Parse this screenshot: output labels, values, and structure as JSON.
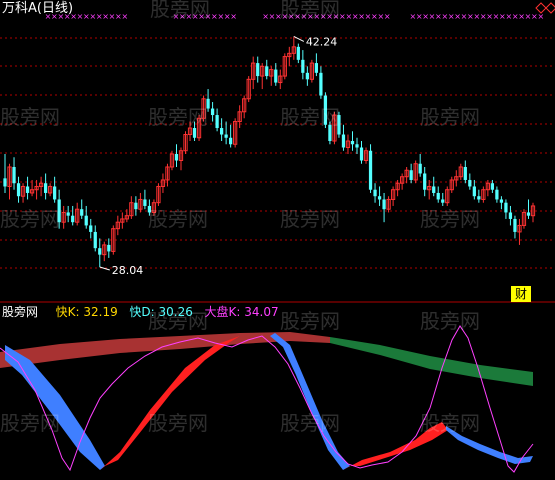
{
  "title": "万科A(日线)",
  "watermark": "股旁网",
  "badge": "财",
  "indicator_name": "股旁网",
  "labels": {
    "high": "42.24",
    "low": "28.04",
    "fastK": "快K: 32.19",
    "fastD": "快D: 30.26",
    "bigK": "大盘K: 34.07"
  },
  "colors": {
    "bg": "#000000",
    "up": "#ff3232",
    "down": "#54ffff",
    "grid": "#b00000",
    "title": "#ffffff",
    "fastK": "#ffd700",
    "fastD": "#54ffff",
    "bigK": "#ff40ff",
    "marker": "#ff40ff",
    "band_up": "#ff2020",
    "band_down": "#3f7fff",
    "band_dark_red": "#a83232",
    "band_green": "#1b7a3a",
    "badge_bg": "#ffff00",
    "badge_text": "#000000"
  },
  "chart_data": [
    {
      "type": "candlestick",
      "title": "万科A(日线)",
      "ylim": [
        26.5,
        43.5
      ],
      "annotations": [
        {
          "text": "42.24",
          "value": 42.24,
          "index": 64
        },
        {
          "text": "28.04",
          "value": 28.04,
          "index": 21
        }
      ],
      "ohlc": [
        [
          33.5,
          35.0,
          32.6,
          33.0
        ],
        [
          33.0,
          34.4,
          32.2,
          34.2
        ],
        [
          34.2,
          34.8,
          32.8,
          33.2
        ],
        [
          33.2,
          33.6,
          32.0,
          32.4
        ],
        [
          32.4,
          33.2,
          32.0,
          33.0
        ],
        [
          33.0,
          33.6,
          32.2,
          32.6
        ],
        [
          32.6,
          33.4,
          32.4,
          32.8
        ],
        [
          32.8,
          33.4,
          32.2,
          33.0
        ],
        [
          33.0,
          33.6,
          32.4,
          33.2
        ],
        [
          33.2,
          33.8,
          32.2,
          32.6
        ],
        [
          32.6,
          33.2,
          32.4,
          33.0
        ],
        [
          33.0,
          33.6,
          32.0,
          32.2
        ],
        [
          32.2,
          32.8,
          30.4,
          30.8
        ],
        [
          30.8,
          31.8,
          30.4,
          31.4
        ],
        [
          31.4,
          31.8,
          30.8,
          31.2
        ],
        [
          31.2,
          31.8,
          30.6,
          30.8
        ],
        [
          30.8,
          32.0,
          30.6,
          31.6
        ],
        [
          31.6,
          32.2,
          31.0,
          31.2
        ],
        [
          31.2,
          31.8,
          30.4,
          30.6
        ],
        [
          30.6,
          31.0,
          29.8,
          30.2
        ],
        [
          30.2,
          30.6,
          29.0,
          29.2
        ],
        [
          29.2,
          29.8,
          28.04,
          28.8
        ],
        [
          28.8,
          29.6,
          28.4,
          29.4
        ],
        [
          29.4,
          29.8,
          28.6,
          29.0
        ],
        [
          29.0,
          30.6,
          28.8,
          30.4
        ],
        [
          30.4,
          31.2,
          30.0,
          30.8
        ],
        [
          30.8,
          31.4,
          30.4,
          31.0
        ],
        [
          31.0,
          31.6,
          30.8,
          31.2
        ],
        [
          31.2,
          32.4,
          31.0,
          32.0
        ],
        [
          32.0,
          32.4,
          31.2,
          31.6
        ],
        [
          31.6,
          32.6,
          31.4,
          32.2
        ],
        [
          32.2,
          32.8,
          31.6,
          31.8
        ],
        [
          31.8,
          32.2,
          31.2,
          31.4
        ],
        [
          31.4,
          32.2,
          31.2,
          32.0
        ],
        [
          32.0,
          33.2,
          31.8,
          33.0
        ],
        [
          33.0,
          33.8,
          32.6,
          33.4
        ],
        [
          33.4,
          34.4,
          33.0,
          34.2
        ],
        [
          34.2,
          35.2,
          34.0,
          35.0
        ],
        [
          35.0,
          35.6,
          34.2,
          34.6
        ],
        [
          34.6,
          35.4,
          34.0,
          35.2
        ],
        [
          35.2,
          36.4,
          35.0,
          36.2
        ],
        [
          36.2,
          37.0,
          35.8,
          36.6
        ],
        [
          36.6,
          37.0,
          35.8,
          36.0
        ],
        [
          36.0,
          37.4,
          35.8,
          37.2
        ],
        [
          37.2,
          38.6,
          37.0,
          38.4
        ],
        [
          38.4,
          39.0,
          37.6,
          37.8
        ],
        [
          37.8,
          38.2,
          37.0,
          37.4
        ],
        [
          37.4,
          37.8,
          36.4,
          36.6
        ],
        [
          36.6,
          37.2,
          35.8,
          36.2
        ],
        [
          36.2,
          37.0,
          35.6,
          36.0
        ],
        [
          36.0,
          36.8,
          35.4,
          35.6
        ],
        [
          35.6,
          37.2,
          35.4,
          37.0
        ],
        [
          37.0,
          38.0,
          36.6,
          37.6
        ],
        [
          37.6,
          38.6,
          37.2,
          38.4
        ],
        [
          38.4,
          39.8,
          38.2,
          39.6
        ],
        [
          39.6,
          41.0,
          39.0,
          40.6
        ],
        [
          40.6,
          41.0,
          39.4,
          39.8
        ],
        [
          39.8,
          40.6,
          39.0,
          40.4
        ],
        [
          40.4,
          40.8,
          39.6,
          39.8
        ],
        [
          39.8,
          40.4,
          39.2,
          40.2
        ],
        [
          40.2,
          40.6,
          39.2,
          39.4
        ],
        [
          39.4,
          40.2,
          39.0,
          39.8
        ],
        [
          39.8,
          41.2,
          39.6,
          41.0
        ],
        [
          41.0,
          41.6,
          40.4,
          41.2
        ],
        [
          41.2,
          42.24,
          40.8,
          41.6
        ],
        [
          41.6,
          41.8,
          40.6,
          40.8
        ],
        [
          40.8,
          41.4,
          39.6,
          40.0
        ],
        [
          40.0,
          40.4,
          39.2,
          39.6
        ],
        [
          39.6,
          40.8,
          39.4,
          40.6
        ],
        [
          40.6,
          41.2,
          39.8,
          40.0
        ],
        [
          40.0,
          40.4,
          38.4,
          38.6
        ],
        [
          38.6,
          38.8,
          36.6,
          36.8
        ],
        [
          36.8,
          37.0,
          35.6,
          35.8
        ],
        [
          35.8,
          37.6,
          35.6,
          37.4
        ],
        [
          37.4,
          37.6,
          36.0,
          36.2
        ],
        [
          36.2,
          36.8,
          35.2,
          35.4
        ],
        [
          35.4,
          36.2,
          35.0,
          35.8
        ],
        [
          35.8,
          36.4,
          35.2,
          35.6
        ],
        [
          35.6,
          36.0,
          35.0,
          35.4
        ],
        [
          35.4,
          35.8,
          34.4,
          34.6
        ],
        [
          34.6,
          35.4,
          34.4,
          35.2
        ],
        [
          35.2,
          35.6,
          32.6,
          32.8
        ],
        [
          32.8,
          33.2,
          32.0,
          32.4
        ],
        [
          32.4,
          33.0,
          31.8,
          32.2
        ],
        [
          32.2,
          32.6,
          30.8,
          31.6
        ],
        [
          31.6,
          32.4,
          31.4,
          32.2
        ],
        [
          32.2,
          33.0,
          31.8,
          32.8
        ],
        [
          32.8,
          33.4,
          32.4,
          33.2
        ],
        [
          33.2,
          33.8,
          32.8,
          33.6
        ],
        [
          33.6,
          34.2,
          33.2,
          34.0
        ],
        [
          34.0,
          34.4,
          33.2,
          33.4
        ],
        [
          33.4,
          34.6,
          33.2,
          34.4
        ],
        [
          34.4,
          35.0,
          33.6,
          33.8
        ],
        [
          33.8,
          34.2,
          32.4,
          32.8
        ],
        [
          32.8,
          33.4,
          32.2,
          33.0
        ],
        [
          33.0,
          33.6,
          32.4,
          32.6
        ],
        [
          32.6,
          33.0,
          32.0,
          32.2
        ],
        [
          32.2,
          32.6,
          31.8,
          32.0
        ],
        [
          32.0,
          33.0,
          31.8,
          32.8
        ],
        [
          32.8,
          33.6,
          32.6,
          33.4
        ],
        [
          33.4,
          34.0,
          33.0,
          33.6
        ],
        [
          33.6,
          34.4,
          33.4,
          34.2
        ],
        [
          34.2,
          34.6,
          33.2,
          33.4
        ],
        [
          33.4,
          33.8,
          32.8,
          33.0
        ],
        [
          33.0,
          33.4,
          32.2,
          32.4
        ],
        [
          32.4,
          32.8,
          32.0,
          32.2
        ],
        [
          32.2,
          33.0,
          32.0,
          32.8
        ],
        [
          32.8,
          33.4,
          32.4,
          33.2
        ],
        [
          33.2,
          33.4,
          32.6,
          32.8
        ],
        [
          32.8,
          33.0,
          32.0,
          32.2
        ],
        [
          32.2,
          32.4,
          31.6,
          32.0
        ],
        [
          32.0,
          32.2,
          31.0,
          31.4
        ],
        [
          31.4,
          31.8,
          30.6,
          31.0
        ],
        [
          31.0,
          31.2,
          29.8,
          30.2
        ],
        [
          30.2,
          31.0,
          29.4,
          30.6
        ],
        [
          30.6,
          31.6,
          30.4,
          31.4
        ],
        [
          31.4,
          32.2,
          31.0,
          31.2
        ],
        [
          31.2,
          32.0,
          30.8,
          31.8
        ]
      ]
    },
    {
      "type": "line",
      "series": [
        {
          "name": "快K",
          "value": 32.19
        },
        {
          "name": "快D",
          "value": 30.26
        },
        {
          "name": "大盘K",
          "value": 34.07
        }
      ]
    }
  ]
}
